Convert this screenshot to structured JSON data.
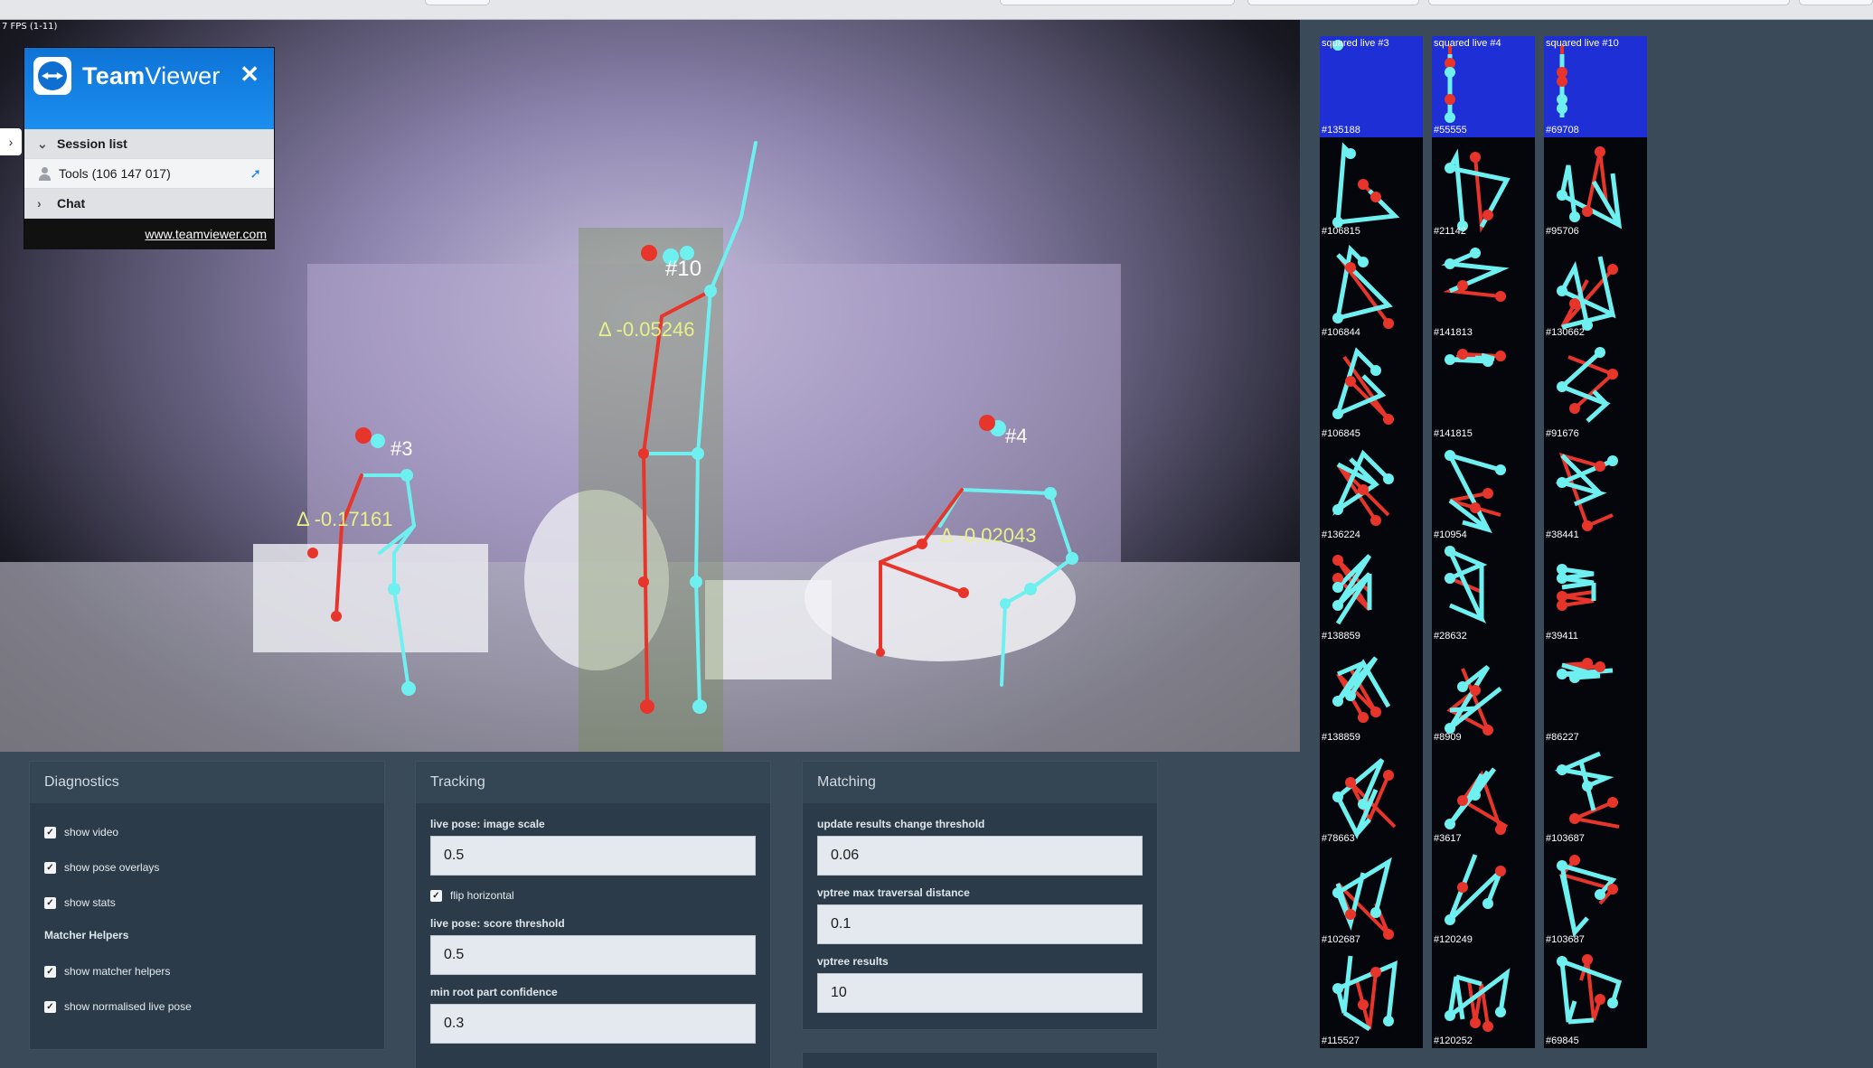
{
  "window": {
    "fps": "7 FPS (1-11)"
  },
  "teamviewer": {
    "title_bold": "Team",
    "title_rest": "Viewer",
    "close": "✕",
    "session_list": "Session list",
    "tools_entry": "Tools (106 147 017)",
    "chat": "Chat",
    "url": "www.teamviewer.com"
  },
  "overlays": {
    "person_10": "#10",
    "person_3": "#3",
    "person_4": "#4",
    "delta_10": "Δ -0.05246",
    "delta_3": "Δ -0.17161",
    "delta_4": "Δ -0.02043"
  },
  "results": {
    "headers": [
      "squared live #3",
      "squared live #4",
      "squared live #10"
    ],
    "columns": [
      [
        "#135188",
        "#106815",
        "#106844",
        "#106845",
        "#136224",
        "#138859",
        "#138859",
        "#78663",
        "#102687",
        "#115527"
      ],
      [
        "#55555",
        "#21142",
        "#141813",
        "#141815",
        "#10954",
        "#28632",
        "#8909",
        "#3617",
        "#120249",
        "#120252"
      ],
      [
        "#69708",
        "#95706",
        "#130662",
        "#91676",
        "#38441",
        "#39411",
        "#86227",
        "#103687",
        "#103687",
        "#69845"
      ]
    ]
  },
  "diagnostics": {
    "title": "Diagnostics",
    "show_video": "show video",
    "show_pose_overlays": "show pose overlays",
    "show_stats": "show stats",
    "matcher_helpers_heading": "Matcher Helpers",
    "show_matcher_helpers": "show matcher helpers",
    "show_normalised_live_pose": "show normalised live pose"
  },
  "tracking": {
    "title": "Tracking",
    "image_scale_label": "live pose: image scale",
    "image_scale_value": "0.5",
    "flip_horizontal": "flip horizontal",
    "score_threshold_label": "live pose: score threshold",
    "score_threshold_value": "0.5",
    "min_root_label": "min root part confidence",
    "min_root_value": "0.3"
  },
  "matching": {
    "title": "Matching",
    "update_threshold_label": "update results change threshold",
    "update_threshold_value": "0.06",
    "vptree_distance_label": "vptree max traversal distance",
    "vptree_distance_value": "0.1",
    "vptree_results_label": "vptree results",
    "vptree_results_value": "10"
  },
  "colors": {
    "pose_cyan": "#6ff0f0",
    "pose_red": "#e8352b",
    "panel_bg": "#2c3b49",
    "page_bg": "#3a4a58"
  }
}
